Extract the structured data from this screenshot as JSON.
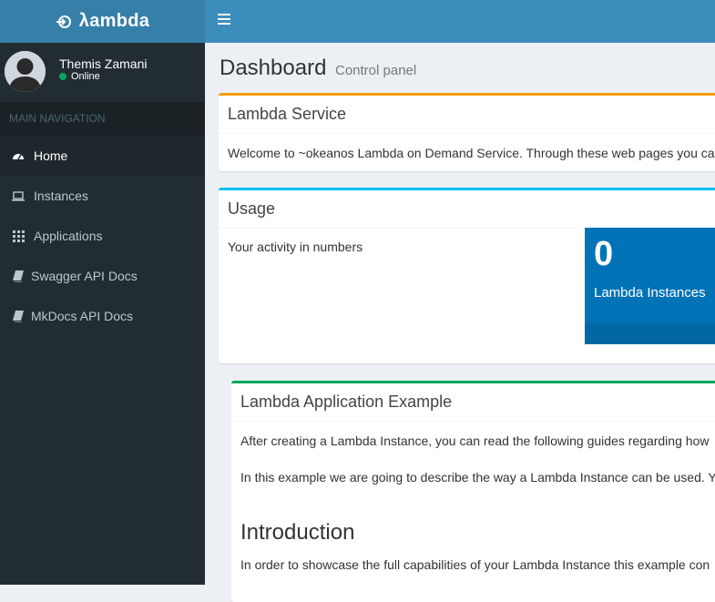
{
  "brand": {
    "name": "λambda",
    "icon": "lambda-logo-icon"
  },
  "header": {
    "menu_icon": "hamburger-icon"
  },
  "user": {
    "name": "Themis Zamani",
    "status": "Online",
    "status_color": "#00a65a",
    "avatar_icon": "user-avatar-icon"
  },
  "sidebar": {
    "header": "MAIN NAVIGATION",
    "items": [
      {
        "label": "Home",
        "icon": "dashboard-icon",
        "active": true
      },
      {
        "label": "Instances",
        "icon": "laptop-icon"
      },
      {
        "label": "Applications",
        "icon": "grid-icon"
      },
      {
        "label": "Swagger API Docs",
        "icon": "book-icon"
      },
      {
        "label": "MkDocs API Docs",
        "icon": "book-icon"
      }
    ]
  },
  "page": {
    "title": "Dashboard",
    "subtitle": "Control panel"
  },
  "service_box": {
    "title": "Lambda Service",
    "text": "Welcome to ~okeanos Lambda on Demand Service. Through these web pages you ca",
    "accent": "#f39c12"
  },
  "usage_box": {
    "title": "Usage",
    "text": "Your activity in numbers",
    "accent": "#00c0ef",
    "stat": {
      "value": "0",
      "label": "Lambda Instances",
      "color": "#0073b7"
    }
  },
  "example_box": {
    "title": "Lambda Application Example",
    "p1": "After creating a Lambda Instance, you can read the following guides regarding how",
    "p2": "In this example we are going to describe the way a Lambda Instance can be used. Y",
    "heading": "Introduction",
    "p3": "In order to showcase the full capabilities of your Lambda Instance this example con",
    "accent": "#00a65a"
  }
}
